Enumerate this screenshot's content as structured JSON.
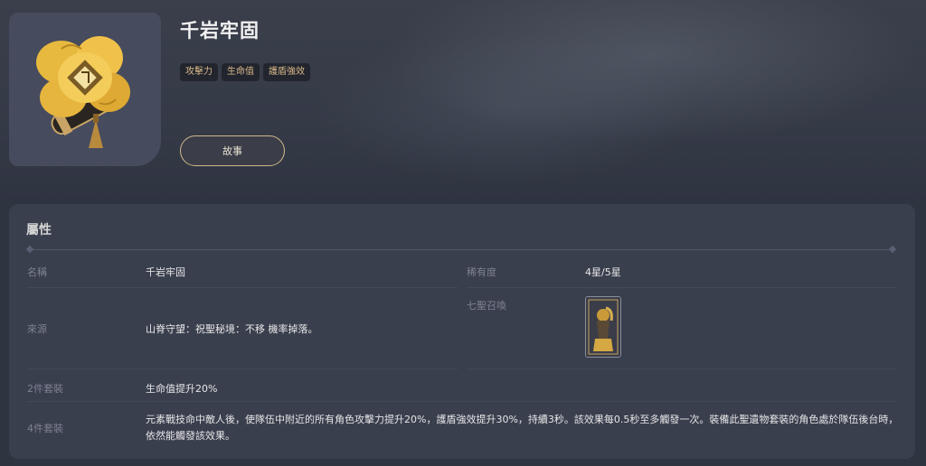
{
  "artifact": {
    "name": "千岩牢固",
    "tags": [
      "攻擊力",
      "生命值",
      "護盾強效"
    ],
    "story_button": "故事",
    "icon": "golden-flower-artifact-icon"
  },
  "attributes": {
    "section_title": "屬性",
    "name_label": "名稱",
    "name_value": "千岩牢固",
    "rarity_label": "稀有度",
    "rarity_value": "4星/5星",
    "source_label": "來源",
    "source_value": "山脊守望：祝聖秘境：不移 機率掉落。",
    "seven_label": "七聖召喚",
    "seven_card_icon": "tcg-card-icon",
    "set2_label": "2件套裝",
    "set2_value": "生命值提升20%",
    "set4_label": "4件套裝",
    "set4_value": "元素戰技命中敵人後，使隊伍中附近的所有角色攻擊力提升20%，護盾強效提升30%，持續3秒。該效果每0.5秒至多觸發一次。裝備此聖遺物套裝的角色處於隊伍後台時，依然能觸發該效果。"
  },
  "colors": {
    "background": "#2f3441",
    "panel": "#3a3f4e",
    "tag_text": "#d9b88a",
    "button_border": "#d2b98c"
  }
}
